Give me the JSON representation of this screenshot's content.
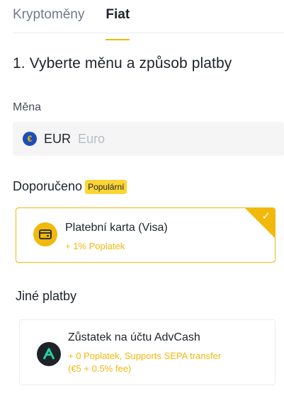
{
  "tabs": [
    {
      "label": "Kryptoměny",
      "active": false
    },
    {
      "label": "Fiat",
      "active": true
    }
  ],
  "step": {
    "title": "1. Vyberte měnu a způsob platby"
  },
  "currency": {
    "label": "Měna",
    "icon": "euro-coin-icon",
    "symbol": "€",
    "code": "EUR",
    "name": "Euro"
  },
  "recommended": {
    "label": "Doporučeno",
    "badge": "Populární",
    "method": {
      "icon": "card-icon",
      "title": "Platební karta (Visa)",
      "fee": "+ 1% Poplatek",
      "selected": true
    }
  },
  "other": {
    "label": "Jiné platby",
    "methods": [
      {
        "icon": "advcash-icon",
        "title": "Zůstatek na účtu AdvCash",
        "fee_line1": "+ 0 Poplatek, Supports SEPA transfer",
        "fee_line2": "(€5 + 0.5% fee)"
      }
    ]
  },
  "colors": {
    "accent": "#f0b90b",
    "badge": "#fcd535",
    "text": "#1e2329",
    "muted": "#707a8a"
  }
}
